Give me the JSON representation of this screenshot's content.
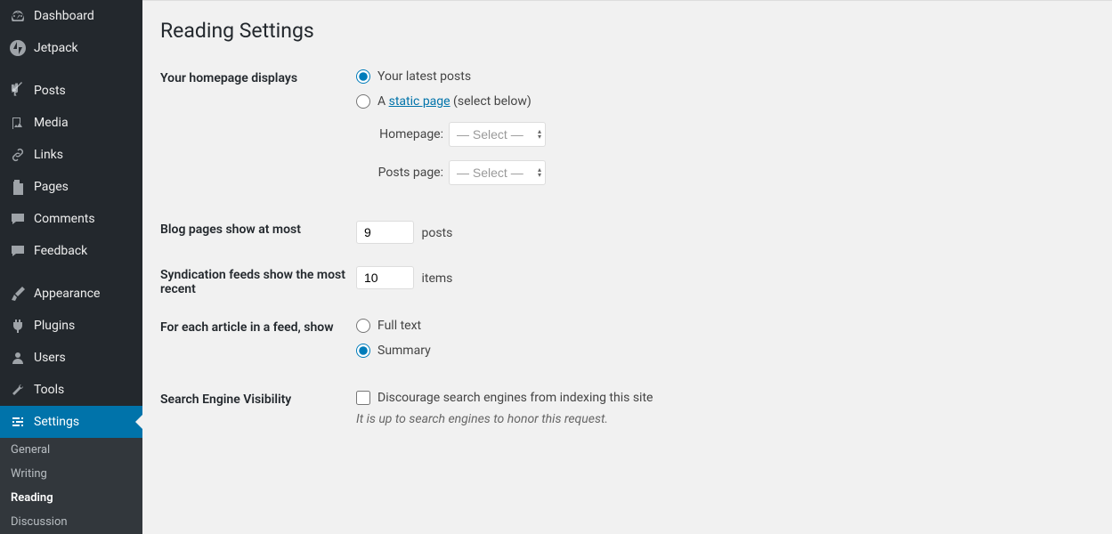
{
  "sidebar": {
    "items": [
      {
        "label": "Dashboard"
      },
      {
        "label": "Jetpack"
      },
      {
        "label": "Posts"
      },
      {
        "label": "Media"
      },
      {
        "label": "Links"
      },
      {
        "label": "Pages"
      },
      {
        "label": "Comments"
      },
      {
        "label": "Feedback"
      },
      {
        "label": "Appearance"
      },
      {
        "label": "Plugins"
      },
      {
        "label": "Users"
      },
      {
        "label": "Tools"
      },
      {
        "label": "Settings"
      }
    ],
    "submenu": [
      {
        "label": "General"
      },
      {
        "label": "Writing"
      },
      {
        "label": "Reading"
      },
      {
        "label": "Discussion"
      }
    ]
  },
  "main": {
    "title": "Reading Settings",
    "homepage": {
      "label": "Your homepage displays",
      "opt1": "Your latest posts",
      "opt2_prefix": "A ",
      "opt2_link": "static page",
      "opt2_suffix": " (select below)",
      "homepage_label": "Homepage:",
      "posts_page_label": "Posts page:",
      "select_placeholder": "— Select —"
    },
    "blog_pages": {
      "label": "Blog pages show at most",
      "value": "9",
      "suffix": "posts"
    },
    "syndication": {
      "label": "Syndication feeds show the most recent",
      "value": "10",
      "suffix": "items"
    },
    "article_feed": {
      "label": "For each article in a feed, show",
      "opt1": "Full text",
      "opt2": "Summary"
    },
    "sev": {
      "label": "Search Engine Visibility",
      "checkbox": "Discourage search engines from indexing this site",
      "desc": "It is up to search engines to honor this request."
    }
  }
}
